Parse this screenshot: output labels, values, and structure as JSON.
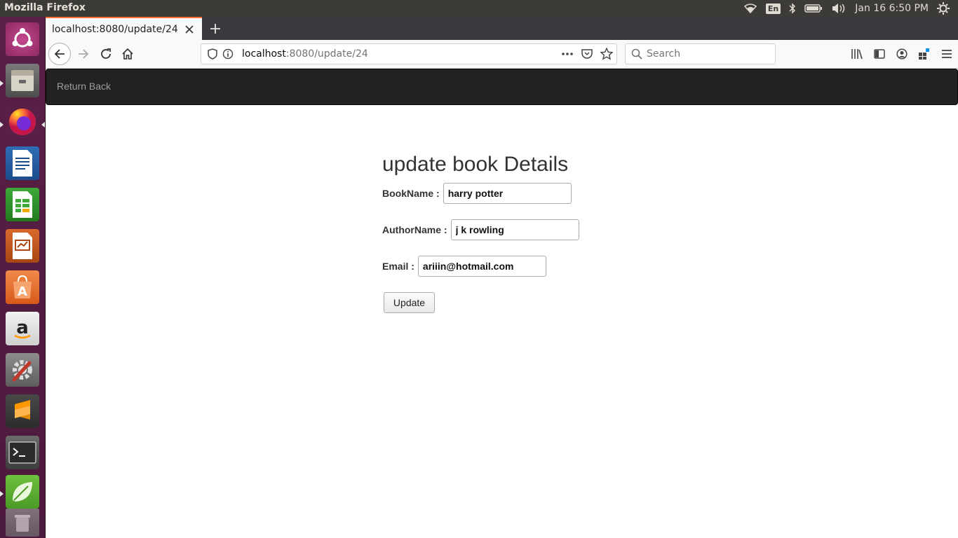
{
  "top_panel": {
    "window_title": "Mozilla Firefox",
    "keyboard_layout": "En",
    "clock": "Jan 16  6:50 PM"
  },
  "launcher": {
    "items": [
      "ubuntu-dash",
      "files",
      "firefox",
      "libreoffice-writer",
      "libreoffice-calc",
      "libreoffice-impress",
      "ubuntu-software",
      "amazon",
      "system-settings",
      "sublime-text",
      "terminal",
      "spring-tool-suite",
      "trash"
    ]
  },
  "browser": {
    "tab_title": "localhost:8080/update/24",
    "url_host": "localhost",
    "url_path": ":8080/update/24",
    "search_placeholder": "Search"
  },
  "app": {
    "nav_link": "Return Back",
    "heading": "update book Details",
    "fields": {
      "book_name_label": "BookName :",
      "book_name_value": "harry potter",
      "author_name_label": "AuthorName :",
      "author_name_value": "j k rowling",
      "email_label": "Email :",
      "email_value": "ariiin@hotmail.com"
    },
    "submit_label": "Update"
  },
  "colors": {
    "launcher_bg": "#4c1a3c",
    "navbar_bg": "#222222",
    "tab_accent": "#ff7139"
  }
}
